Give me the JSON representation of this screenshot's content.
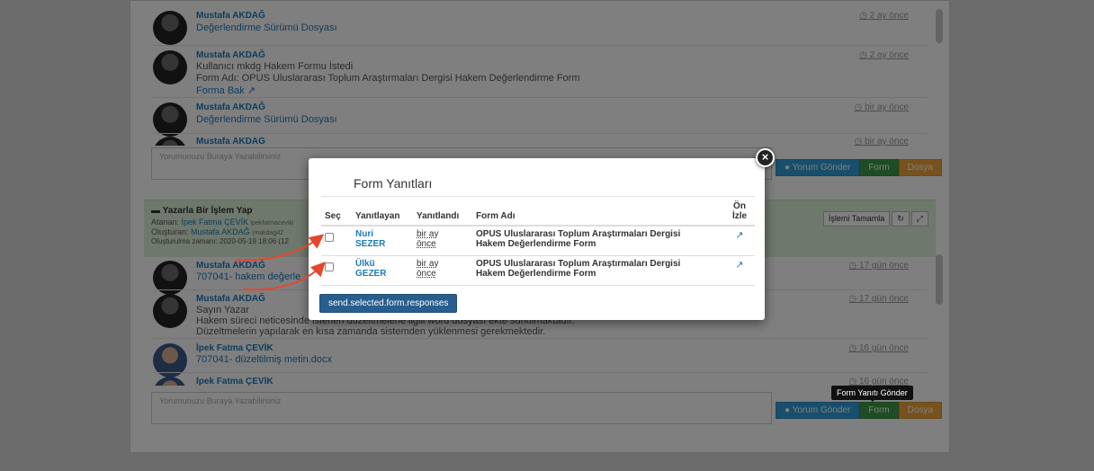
{
  "feed_top": [
    {
      "name": "Mustafa AKDAĞ",
      "lines": [
        "Değerlendirme Sürümü Dosyası"
      ],
      "time": "2 ay önce"
    },
    {
      "name": "Mustafa AKDAĞ",
      "lines": [
        "Kullanıcı mkdg Hakem Formu İstedi",
        "Form Adı: OPUS Uluslararası Toplum Araştırmaları Dergisi Hakem Değerlendirme Form",
        "Forma Bak"
      ],
      "time": "2 ay önce"
    },
    {
      "name": "Mustafa AKDAĞ",
      "lines": [
        "Değerlendirme Sürümü Dosyası"
      ],
      "time": "bir ay önce"
    },
    {
      "name": "Mustafa AKDAĞ",
      "lines": [],
      "time": "bir ay önce"
    }
  ],
  "comment_placeholder": "Yorumunuzu Buraya Yazabilirsiniz",
  "buttons": {
    "comment": "Yorum Gönder",
    "form": "Form",
    "file": "Dosya"
  },
  "action_panel": {
    "title": "Yazarla Bir İşlem Yap",
    "assigned_label": "Atanan:",
    "assigned_name": "İpek Fatma ÇEVİK",
    "assigned_extra": "ipekfatmaceviki",
    "created_by_label": "Oluşturan:",
    "created_by_name": "Mustafa AKDAĞ",
    "created_by_extra": "(makdag42",
    "created_time": "Oluşturulma zamanı: 2020-05-19 18:06 (12",
    "complete_btn": "İşlemi Tamamla",
    "refresh_icon": "↻",
    "expand_icon": "⤢"
  },
  "feed_bottom": [
    {
      "name": "Mustafa AKDAĞ",
      "lines": [
        "707041- hakem değerle"
      ],
      "time": "17 gün önce"
    },
    {
      "name": "Mustafa AKDAĞ",
      "lines": [
        "Sayın Yazar",
        "Hakem süreci neticesinde istenen düzeltmelerle ilgili word dosyası ekte sunulmaktadır.",
        "Düzeltmelerin yapılarak en kısa zamanda sistemden yüklenmesi gerekmektedir."
      ],
      "time": "17 gün önce"
    },
    {
      "name": "İpek Fatma ÇEVİK",
      "lines": [
        "707041- düzeltilmiş metin.docx"
      ],
      "time": "16 gün önce"
    },
    {
      "name": "İpek Fatma ÇEVİK",
      "lines": [],
      "time": "16 gün önce"
    }
  ],
  "tooltip": "Form Yanıtı Gönder",
  "modal": {
    "title": "Form Yanıtları",
    "close_glyph": "×",
    "headers": {
      "select": "Seç",
      "responder": "Yanıtlayan",
      "answered": "Yanıtlandı",
      "form_name": "Form Adı",
      "preview_1": "Ön",
      "preview_2": "İzle"
    },
    "rows": [
      {
        "responder_first": "Nuri",
        "responder_last": "SEZER",
        "answered_1": "bir ay",
        "answered_2": "önce",
        "form_name_1": "OPUS Uluslararası Toplum Araştırmaları Dergisi",
        "form_name_2": "Hakem Değerlendirme Form",
        "preview_icon": "external-link-icon"
      },
      {
        "responder_first": "Ülkü",
        "responder_last": "GEZER",
        "answered_1": "bir ay",
        "answered_2": "önce",
        "form_name_1": "OPUS Uluslararası Toplum Araştırmaları Dergisi",
        "form_name_2": "Hakem Değerlendirme Form",
        "preview_icon": "external-link-icon"
      }
    ],
    "send_button": "send.selected.form.responses"
  },
  "colors": {
    "accent": "#1e7ab8",
    "send_button": "#285e8e",
    "arrow": "#e8452c"
  }
}
